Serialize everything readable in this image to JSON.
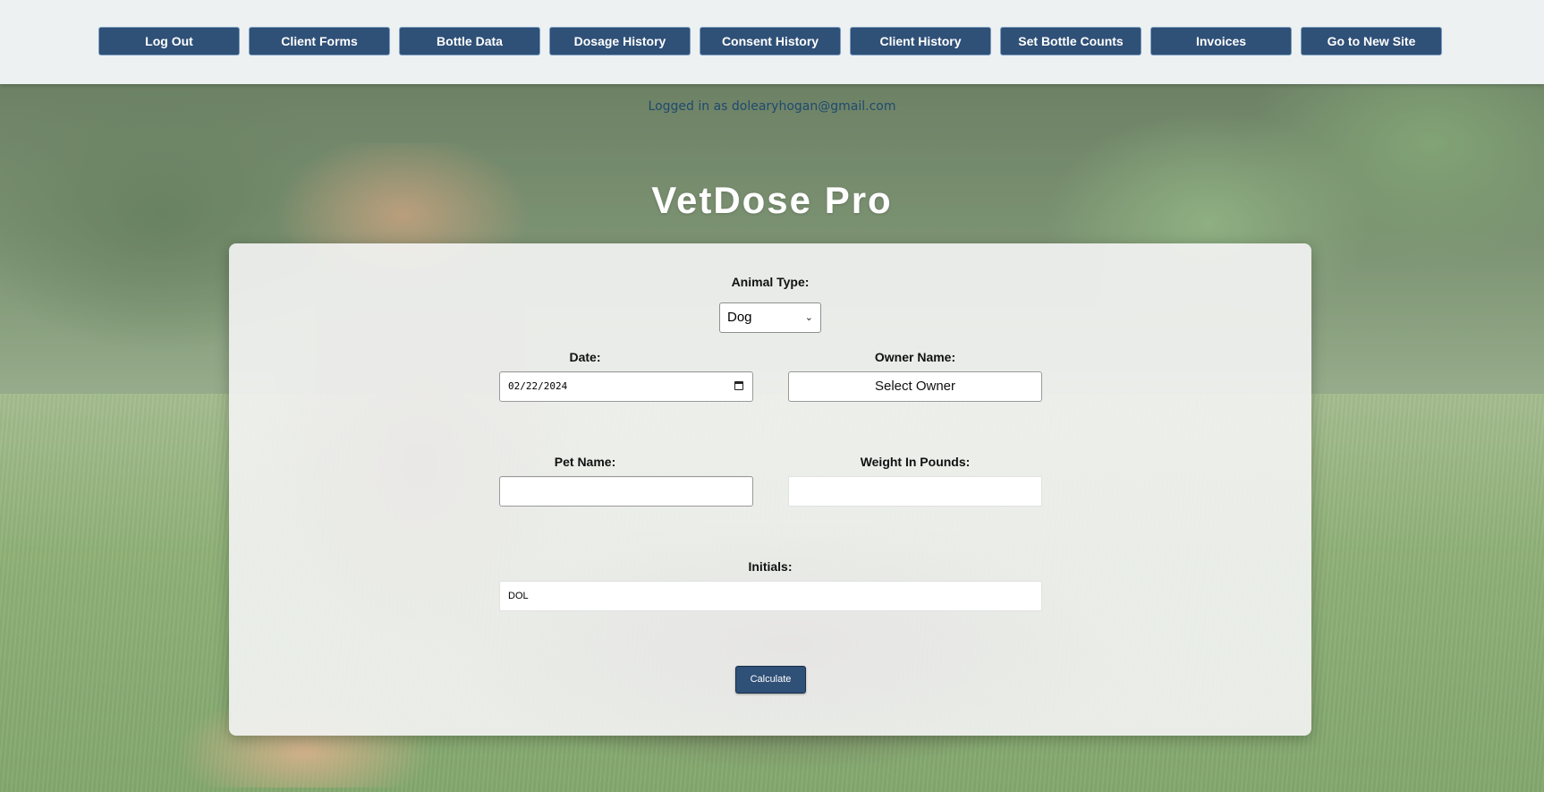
{
  "nav": {
    "buttons": [
      {
        "label": "Log Out"
      },
      {
        "label": "Client Forms"
      },
      {
        "label": "Bottle Data"
      },
      {
        "label": "Dosage History"
      },
      {
        "label": "Consent History"
      },
      {
        "label": "Client History"
      },
      {
        "label": "Set Bottle Counts"
      },
      {
        "label": "Invoices"
      },
      {
        "label": "Go to New Site"
      }
    ]
  },
  "header": {
    "logged_in_text": "Logged in as dolearyhogan@gmail.com",
    "title": "VetDose Pro"
  },
  "form": {
    "animal_type": {
      "label": "Animal Type:",
      "value": "Dog"
    },
    "date": {
      "label": "Date:",
      "value": "02/22/2024"
    },
    "owner": {
      "label": "Owner Name:",
      "button_label": "Select Owner"
    },
    "pet_name": {
      "label": "Pet Name:",
      "value": ""
    },
    "weight": {
      "label": "Weight In Pounds:",
      "value": ""
    },
    "initials": {
      "label": "Initials:",
      "value": "DOL"
    },
    "calculate_label": "Calculate"
  },
  "colors": {
    "nav_button": "#2f5077",
    "nav_bar": "#edf1f2",
    "logged_in_text": "#1f4a6e",
    "card": "#f4f4f4"
  },
  "icons": {
    "date_picker": "calendar-icon",
    "select_arrow": "chevron-down-icon"
  }
}
